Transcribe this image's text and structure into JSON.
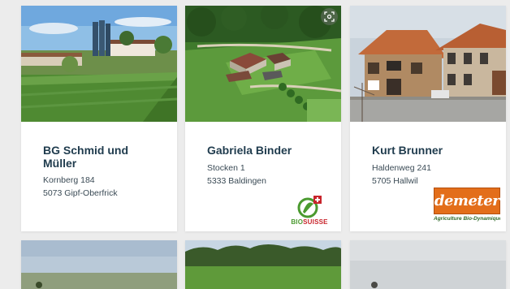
{
  "cards": [
    {
      "name": "BG Schmid und Müller",
      "street": "Kornberg 184",
      "city": "5073 Gipf-Oberfrick"
    },
    {
      "name": "Gabriela Binder",
      "street": "Stocken 1",
      "city": "5333 Baldingen",
      "logo": {
        "part1": "BIO",
        "part2": "SUISSE",
        "color_green": "#4a9a2f",
        "color_red": "#c8242b"
      }
    },
    {
      "name": "Kurt Brunner",
      "street": "Haldenweg 241",
      "city": "5705 Hallwil",
      "logo": {
        "word": "demeter",
        "tagline": "Agriculture Bio-Dynamique",
        "color": "#e36e1a"
      }
    }
  ],
  "colors": {
    "name_text": "#1f3b4d",
    "address_text": "#3a4a55",
    "background": "#ececec"
  },
  "icons": {
    "zoom": "zoom-focus-icon"
  }
}
